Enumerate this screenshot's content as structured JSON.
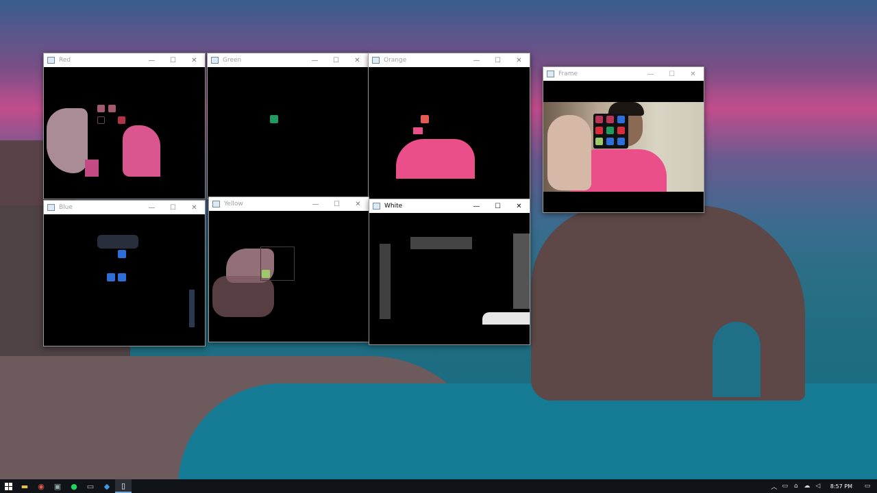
{
  "windows": {
    "red": {
      "title": "Red"
    },
    "green": {
      "title": "Green"
    },
    "orange": {
      "title": "Orange"
    },
    "frame": {
      "title": "Frame"
    },
    "blue": {
      "title": "Blue"
    },
    "yellow": {
      "title": "Yellow"
    },
    "white": {
      "title": "White"
    }
  },
  "window_controls": {
    "minimize": "—",
    "maximize": "☐",
    "close": "✕"
  },
  "taskbar": {
    "start_icon": "windows-start-icon",
    "apps": [
      {
        "name": "file-explorer-icon",
        "glyph": "▬"
      },
      {
        "name": "chrome-icon",
        "glyph": "◉"
      },
      {
        "name": "network-app-icon",
        "glyph": "▣"
      },
      {
        "name": "spotify-icon",
        "glyph": "●"
      },
      {
        "name": "terminal-icon",
        "glyph": "▭"
      },
      {
        "name": "vscode-icon",
        "glyph": "◆"
      },
      {
        "name": "notepad-icon",
        "glyph": "▯"
      }
    ],
    "tray": {
      "chevron": "︿",
      "clock": "8:57 PM",
      "notification_glyph": "▭"
    }
  },
  "colors": {
    "red_mask": "#d9578e",
    "green_cell": "#239a5d",
    "orange_cell": "#e15b4e",
    "blue_cell": "#2d6ed8",
    "yellow_cell": "#9fc86b",
    "shirt_pink": "#ea4f8a"
  }
}
